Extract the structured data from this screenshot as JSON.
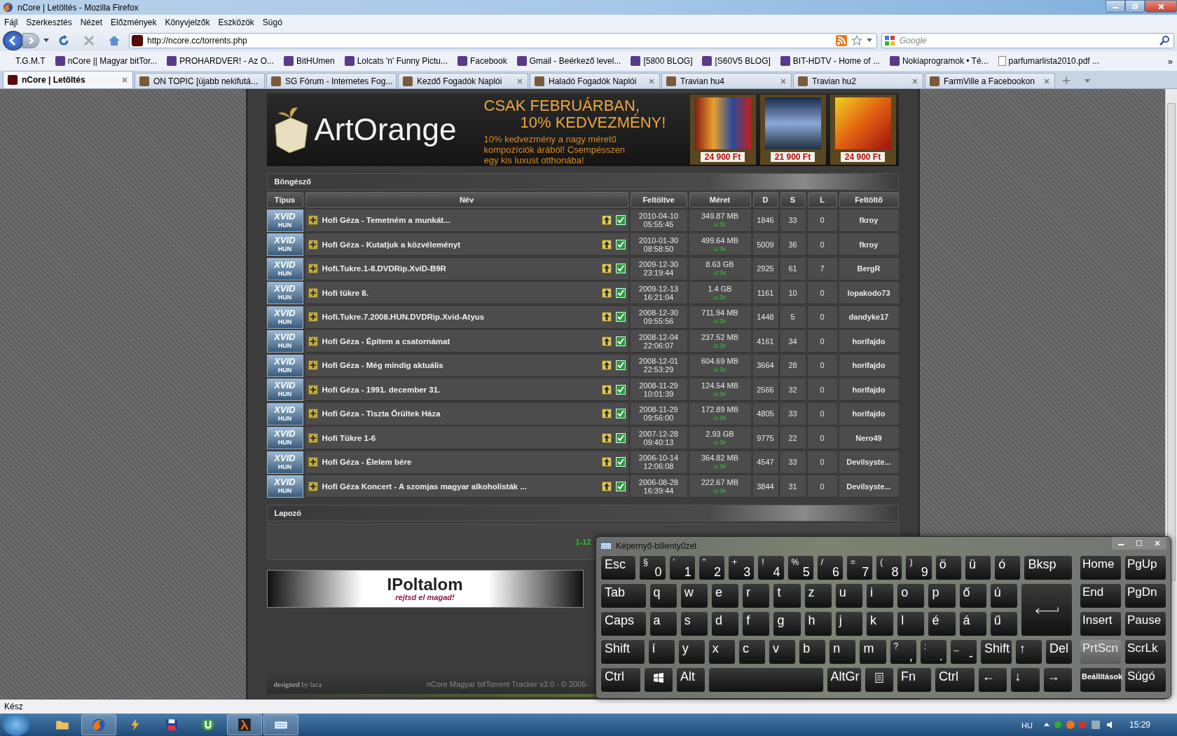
{
  "window": {
    "title": "nCore | Letöltés - Mozilla Firefox"
  },
  "menu": [
    "Fájl",
    "Szerkesztés",
    "Nézet",
    "Előzmények",
    "Könyvjelzők",
    "Eszközök",
    "Súgó"
  ],
  "address": {
    "url": "http://ncore.cc/torrents.php"
  },
  "search": {
    "placeholder": "Google"
  },
  "bookmarks": [
    {
      "label": "T.G.M.T",
      "kind": "plain"
    },
    {
      "label": "nCore || Magyar bitTor...",
      "kind": "site"
    },
    {
      "label": "PROHARDVER! - Az O...",
      "kind": "site"
    },
    {
      "label": "BitHUmen",
      "kind": "site"
    },
    {
      "label": "Lolcats 'n' Funny Pictu...",
      "kind": "site"
    },
    {
      "label": "Facebook",
      "kind": "site"
    },
    {
      "label": "Gmail - Beérkező level...",
      "kind": "site"
    },
    {
      "label": "[5800 BLOG]",
      "kind": "site"
    },
    {
      "label": "[S60V5 BLOG]",
      "kind": "site"
    },
    {
      "label": "BIT-HDTV - Home of ...",
      "kind": "site"
    },
    {
      "label": "Nokiaprogramok • Té...",
      "kind": "site"
    },
    {
      "label": "parfumarlista2010.pdf ...",
      "kind": "file"
    }
  ],
  "bookmarks_more": "»",
  "tabs": [
    {
      "label": "nCore | Letöltés",
      "selected": true
    },
    {
      "label": "ON TOPIC [újabb nekifutá...",
      "selected": false
    },
    {
      "label": "SG Fórum - Internetes Fog...",
      "selected": false
    },
    {
      "label": "Kezdő Fogadók Naplói",
      "selected": false
    },
    {
      "label": "Haladó Fogadók Naplói",
      "selected": false
    },
    {
      "label": "Travian hu4",
      "selected": false
    },
    {
      "label": "Travian hu2",
      "selected": false
    },
    {
      "label": "FarmVille a Facebookon",
      "selected": false
    }
  ],
  "banner": {
    "brand": "ArtOrange",
    "headline": [
      "CSAK FEBRUÁRBAN,",
      "10% KEDVEZMÉNY!"
    ],
    "text": "10% kedvezmény a nagy méretű kompozíciók árából! Csempésszen egy kis luxust otthonába!",
    "prices": [
      "24 900 Ft",
      "21 900 Ft",
      "24 900 Ft"
    ]
  },
  "browser": {
    "title": "Böngésző",
    "columns": [
      "Típus",
      "Név",
      "Feltöltve",
      "Méret",
      "D",
      "S",
      "L",
      "Feltöltő"
    ],
    "rows": [
      {
        "category": "XVID",
        "language": "HUN",
        "name": "Hofi Géza - Temetném a munkát...",
        "date": "2010-04-10",
        "time": "05:55:45",
        "size": "349.87 MB",
        "ratio": "u:3x",
        "d": "1846",
        "s": "33",
        "l": "0",
        "uploader": "fkroy"
      },
      {
        "category": "XVID",
        "language": "HUN",
        "name": "Hofi Géza - Kutatjuk a közvéleményt",
        "date": "2010-01-30",
        "time": "08:58:50",
        "size": "499.64 MB",
        "ratio": "u:3x",
        "d": "5009",
        "s": "36",
        "l": "0",
        "uploader": "fkroy"
      },
      {
        "category": "XVID",
        "language": "HUN",
        "name": "Hofi.Tukre.1-8.DVDRip.XviD-B9R",
        "date": "2009-12-30",
        "time": "23:19:44",
        "size": "8.63 GB",
        "ratio": "u:3x",
        "d": "2925",
        "s": "61",
        "l": "7",
        "uploader": "BergR"
      },
      {
        "category": "XVID",
        "language": "HUN",
        "name": "Hofi tükre 8.",
        "date": "2009-12-13",
        "time": "16:21:04",
        "size": "1.4 GB",
        "ratio": "u:3x",
        "d": "1161",
        "s": "10",
        "l": "0",
        "uploader": "lopakodo73"
      },
      {
        "category": "XVID",
        "language": "HUN",
        "name": "Hofi.Tukre.7.2008.HUN.DVDRip.Xvid-Atyus",
        "date": "2008-12-30",
        "time": "09:55:56",
        "size": "711.94 MB",
        "ratio": "u:3x",
        "d": "1448",
        "s": "5",
        "l": "0",
        "uploader": "dandyke17"
      },
      {
        "category": "XVID",
        "language": "HUN",
        "name": "Hofi Géza - Építem a csatornámat",
        "date": "2008-12-04",
        "time": "22:06:07",
        "size": "237.52 MB",
        "ratio": "u:3x",
        "d": "4161",
        "s": "34",
        "l": "0",
        "uploader": "horifajdo"
      },
      {
        "category": "XVID",
        "language": "HUN",
        "name": "Hofi Géza - Még mindig aktuális",
        "date": "2008-12-01",
        "time": "22:53:29",
        "size": "604.69 MB",
        "ratio": "u:3x",
        "d": "3664",
        "s": "28",
        "l": "0",
        "uploader": "horifajdo"
      },
      {
        "category": "XVID",
        "language": "HUN",
        "name": "Hofi Géza - 1991. december 31.",
        "date": "2008-11-29",
        "time": "10:01:39",
        "size": "124.54 MB",
        "ratio": "u:3x",
        "d": "2566",
        "s": "32",
        "l": "0",
        "uploader": "horifajdo"
      },
      {
        "category": "XVID",
        "language": "HUN",
        "name": "Hofi Géza - Tiszta Őrültek Háza",
        "date": "2008-11-29",
        "time": "09:56:00",
        "size": "172.89 MB",
        "ratio": "u:3x",
        "d": "4805",
        "s": "33",
        "l": "0",
        "uploader": "horifajdo"
      },
      {
        "category": "XVID",
        "language": "HUN",
        "name": "Hofi Tükre 1-6",
        "date": "2007-12-28",
        "time": "09:40:13",
        "size": "2.93 GB",
        "ratio": "u:3x",
        "d": "9775",
        "s": "22",
        "l": "0",
        "uploader": "Nero49"
      },
      {
        "category": "XVID",
        "language": "HUN",
        "name": "Hofi Géza - Élelem bére",
        "date": "2006-10-14",
        "time": "12:06:08",
        "size": "364.82 MB",
        "ratio": "u:3x",
        "d": "4547",
        "s": "33",
        "l": "0",
        "uploader": "Devilsyste..."
      },
      {
        "category": "XVID",
        "language": "HUN",
        "name": "Hofi Géza Koncert - A szomjas magyar alkoholisták ...",
        "date": "2006-08-28",
        "time": "16:39:44",
        "size": "222.67 MB",
        "ratio": "u:3x",
        "d": "3844",
        "s": "31",
        "l": "0",
        "uploader": "Devilsyste..."
      }
    ]
  },
  "pager": {
    "title": "Lapozó",
    "range": "1-12"
  },
  "ad": {
    "brand": "IPoltalom",
    "slogan": "rejtsd el magad!"
  },
  "footer": {
    "credit": "**designed** by laca",
    "copyright": "nCore Magyar bitTorrent Tracker v3.0 - © 2005-"
  },
  "status": "Kész",
  "keyboard": {
    "title": "Képernyő-billentyűzet",
    "number_row": [
      {
        "label": "Esc",
        "kind": "wide"
      },
      {
        "shift": "§",
        "label": "0",
        "kind": "normal"
      },
      {
        "shift": "'",
        "label": "1",
        "kind": "normal"
      },
      {
        "shift": "\"",
        "label": "2",
        "kind": "normal"
      },
      {
        "shift": "+",
        "label": "3",
        "kind": "normal"
      },
      {
        "shift": "!",
        "label": "4",
        "kind": "normal"
      },
      {
        "shift": "%",
        "label": "5",
        "kind": "normal"
      },
      {
        "shift": "/",
        "label": "6",
        "kind": "normal"
      },
      {
        "shift": "=",
        "label": "7",
        "kind": "normal"
      },
      {
        "shift": "(",
        "label": "8",
        "kind": "normal"
      },
      {
        "shift": ")",
        "label": "9",
        "kind": "normal"
      },
      {
        "label": "ö",
        "kind": "normal"
      },
      {
        "label": "ü",
        "kind": "normal"
      },
      {
        "label": "ó",
        "kind": "normal"
      },
      {
        "label": "Bksp",
        "kind": "widest"
      }
    ],
    "top_row": [
      {
        "label": "Tab",
        "kind": "wider"
      },
      {
        "label": "q",
        "kind": "normal"
      },
      {
        "label": "w",
        "kind": "normal"
      },
      {
        "label": "e",
        "kind": "normal"
      },
      {
        "label": "r",
        "kind": "normal"
      },
      {
        "label": "t",
        "kind": "normal"
      },
      {
        "label": "z",
        "kind": "normal"
      },
      {
        "label": "u",
        "kind": "normal"
      },
      {
        "label": "i",
        "kind": "normal"
      },
      {
        "label": "o",
        "kind": "normal"
      },
      {
        "label": "p",
        "kind": "normal"
      },
      {
        "label": "ő",
        "kind": "normal"
      },
      {
        "label": "ú",
        "kind": "normal"
      },
      {
        "kind": "enter"
      }
    ],
    "home_row": [
      {
        "label": "Caps",
        "kind": "wider"
      },
      {
        "label": "a",
        "kind": "normal"
      },
      {
        "label": "s",
        "kind": "normal"
      },
      {
        "label": "d",
        "kind": "normal"
      },
      {
        "label": "f",
        "kind": "normal"
      },
      {
        "label": "g",
        "kind": "normal"
      },
      {
        "label": "h",
        "kind": "normal"
      },
      {
        "label": "j",
        "kind": "normal"
      },
      {
        "label": "k",
        "kind": "normal"
      },
      {
        "label": "l",
        "kind": "normal"
      },
      {
        "label": "é",
        "kind": "normal"
      },
      {
        "label": "á",
        "kind": "normal"
      },
      {
        "label": "ű",
        "kind": "normal"
      }
    ],
    "bottom_row": [
      {
        "label": "Shift",
        "kind": "wider"
      },
      {
        "label": "í",
        "kind": "normal"
      },
      {
        "label": "y",
        "kind": "normal"
      },
      {
        "label": "x",
        "kind": "normal"
      },
      {
        "label": "c",
        "kind": "normal"
      },
      {
        "label": "v",
        "kind": "normal"
      },
      {
        "label": "b",
        "kind": "normal"
      },
      {
        "label": "n",
        "kind": "normal"
      },
      {
        "label": "m",
        "kind": "normal"
      },
      {
        "shift": "?",
        "label": ",",
        "kind": "normal"
      },
      {
        "shift": ":",
        "label": ".",
        "kind": "normal"
      },
      {
        "shift": "_",
        "label": "-",
        "kind": "normal"
      },
      {
        "label": "Shift",
        "kind": "medium"
      },
      {
        "label": "↑",
        "kind": "normal"
      },
      {
        "label": "Del",
        "kind": "normal"
      }
    ],
    "modifier_row": [
      {
        "label": "Ctrl",
        "kind": "wide"
      },
      {
        "kind": "windows"
      },
      {
        "label": "Alt",
        "kind": "normal"
      },
      {
        "kind": "space"
      },
      {
        "label": "AltGr",
        "kind": "medium"
      },
      {
        "kind": "menu"
      },
      {
        "label": "Fn",
        "kind": "medium"
      },
      {
        "label": "Ctrl",
        "kind": "wide"
      },
      {
        "label": "←",
        "kind": "normal"
      },
      {
        "label": "↓",
        "kind": "normal"
      },
      {
        "label": "→",
        "kind": "normal"
      }
    ],
    "side": [
      {
        "label": "Home",
        "active": false
      },
      {
        "label": "PgUp",
        "active": false
      },
      {
        "label": "End",
        "active": false
      },
      {
        "label": "PgDn",
        "active": false
      },
      {
        "label": "Insert",
        "active": false
      },
      {
        "label": "Pause",
        "active": false
      },
      {
        "label": "PrtScn",
        "active": true
      },
      {
        "label": "ScrLk",
        "active": false
      },
      {
        "label": "Beállítások",
        "active": false
      },
      {
        "label": "Súgó",
        "active": false
      }
    ]
  },
  "taskbar": {
    "apps": [
      {
        "kind": "folder",
        "selected": false
      },
      {
        "kind": "browser",
        "selected": true
      },
      {
        "kind": "player",
        "selected": false
      },
      {
        "kind": "disk",
        "selected": false
      },
      {
        "kind": "torrent",
        "selected": false
      },
      {
        "kind": "game",
        "selected": true
      },
      {
        "kind": "keyboard",
        "selected": true
      }
    ],
    "language": "HU",
    "clock": "15:29"
  }
}
